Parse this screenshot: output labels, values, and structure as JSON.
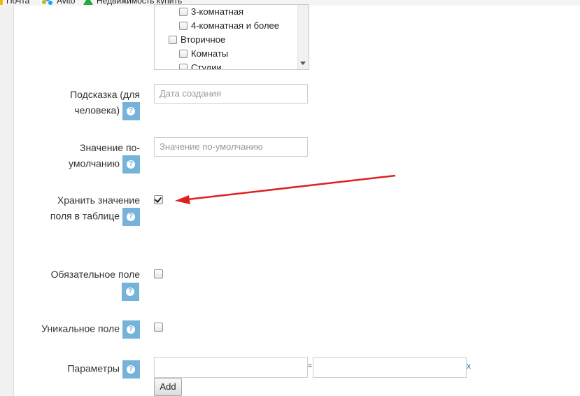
{
  "bookmarks": [
    {
      "label": "Почта",
      "icon": "mail-icon"
    },
    {
      "label": "Avito",
      "icon": "avito-icon"
    },
    {
      "label": "Недвижимость купить",
      "icon": "realty-icon"
    }
  ],
  "listbox": {
    "items": [
      {
        "label": "3-комнатная",
        "indent": 2
      },
      {
        "label": "4-комнатная и более",
        "indent": 2
      },
      {
        "label": "Вторичное",
        "indent": 1
      },
      {
        "label": "Комнаты",
        "indent": 2
      },
      {
        "label": "Студии",
        "indent": 2
      }
    ]
  },
  "fields": {
    "hint": {
      "label_line1": "Подсказка (для",
      "label_line2": "человека)",
      "placeholder": "Дата создания"
    },
    "default": {
      "label_line1": "Значение по-",
      "label_line2": "умолчанию",
      "placeholder": "Значение по-умолчанию"
    },
    "store": {
      "label_line1": "Хранить значение",
      "label_line2": "поля в таблице",
      "checked": true
    },
    "required": {
      "label": "Обязательное поле",
      "checked": false
    },
    "unique": {
      "label": "Уникальное поле",
      "checked": false
    },
    "params": {
      "label": "Параметры",
      "key_value": "",
      "value_value": "",
      "separator": "=",
      "remove": "x"
    }
  },
  "add_button": "Add",
  "help_icon_glyph": "?",
  "annotation_color": "#e02020"
}
